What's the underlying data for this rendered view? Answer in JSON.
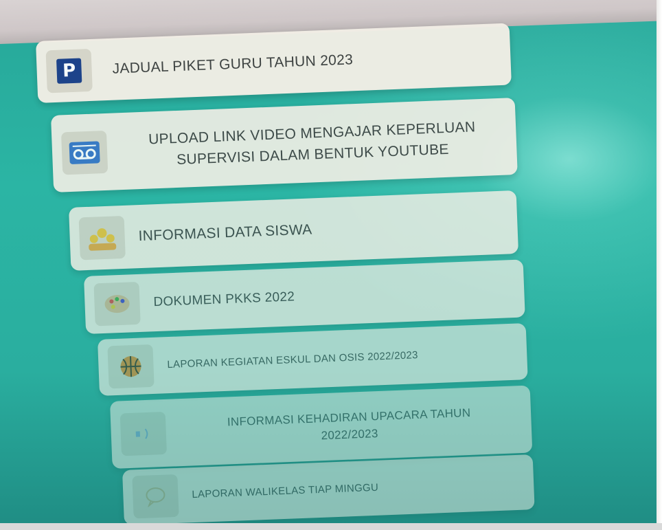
{
  "menu": {
    "items": [
      {
        "label": "JADUAL PIKET GURU TAHUN 2023",
        "icon": "p-parking-icon"
      },
      {
        "label": "UPLOAD LINK VIDEO MENGAJAR KEPERLUAN\nSUPERVISI DALAM BENTUK YOUTUBE",
        "icon": "voicemail-tape-icon"
      },
      {
        "label": "INFORMASI DATA SISWA",
        "icon": "students-group-icon"
      },
      {
        "label": "DOKUMEN PKKS 2022",
        "icon": "palette-icon"
      },
      {
        "label": "LAPORAN KEGIATAN ESKUL DAN OSIS 2022/2023",
        "icon": "basketball-icon"
      },
      {
        "label": "INFORMASI KEHADIRAN UPACARA TAHUN\n2022/2023",
        "icon": "audio-icon"
      },
      {
        "label": "LAPORAN WALIKELAS TIAP MINGGU",
        "icon": "speech-bubble-icon"
      }
    ]
  },
  "colors": {
    "background": "#2bb5a4",
    "card": "#f3efe6",
    "icon_box": "#ddd7cb",
    "text": "#3f3f3f",
    "p_icon": "#1d3f8a"
  }
}
